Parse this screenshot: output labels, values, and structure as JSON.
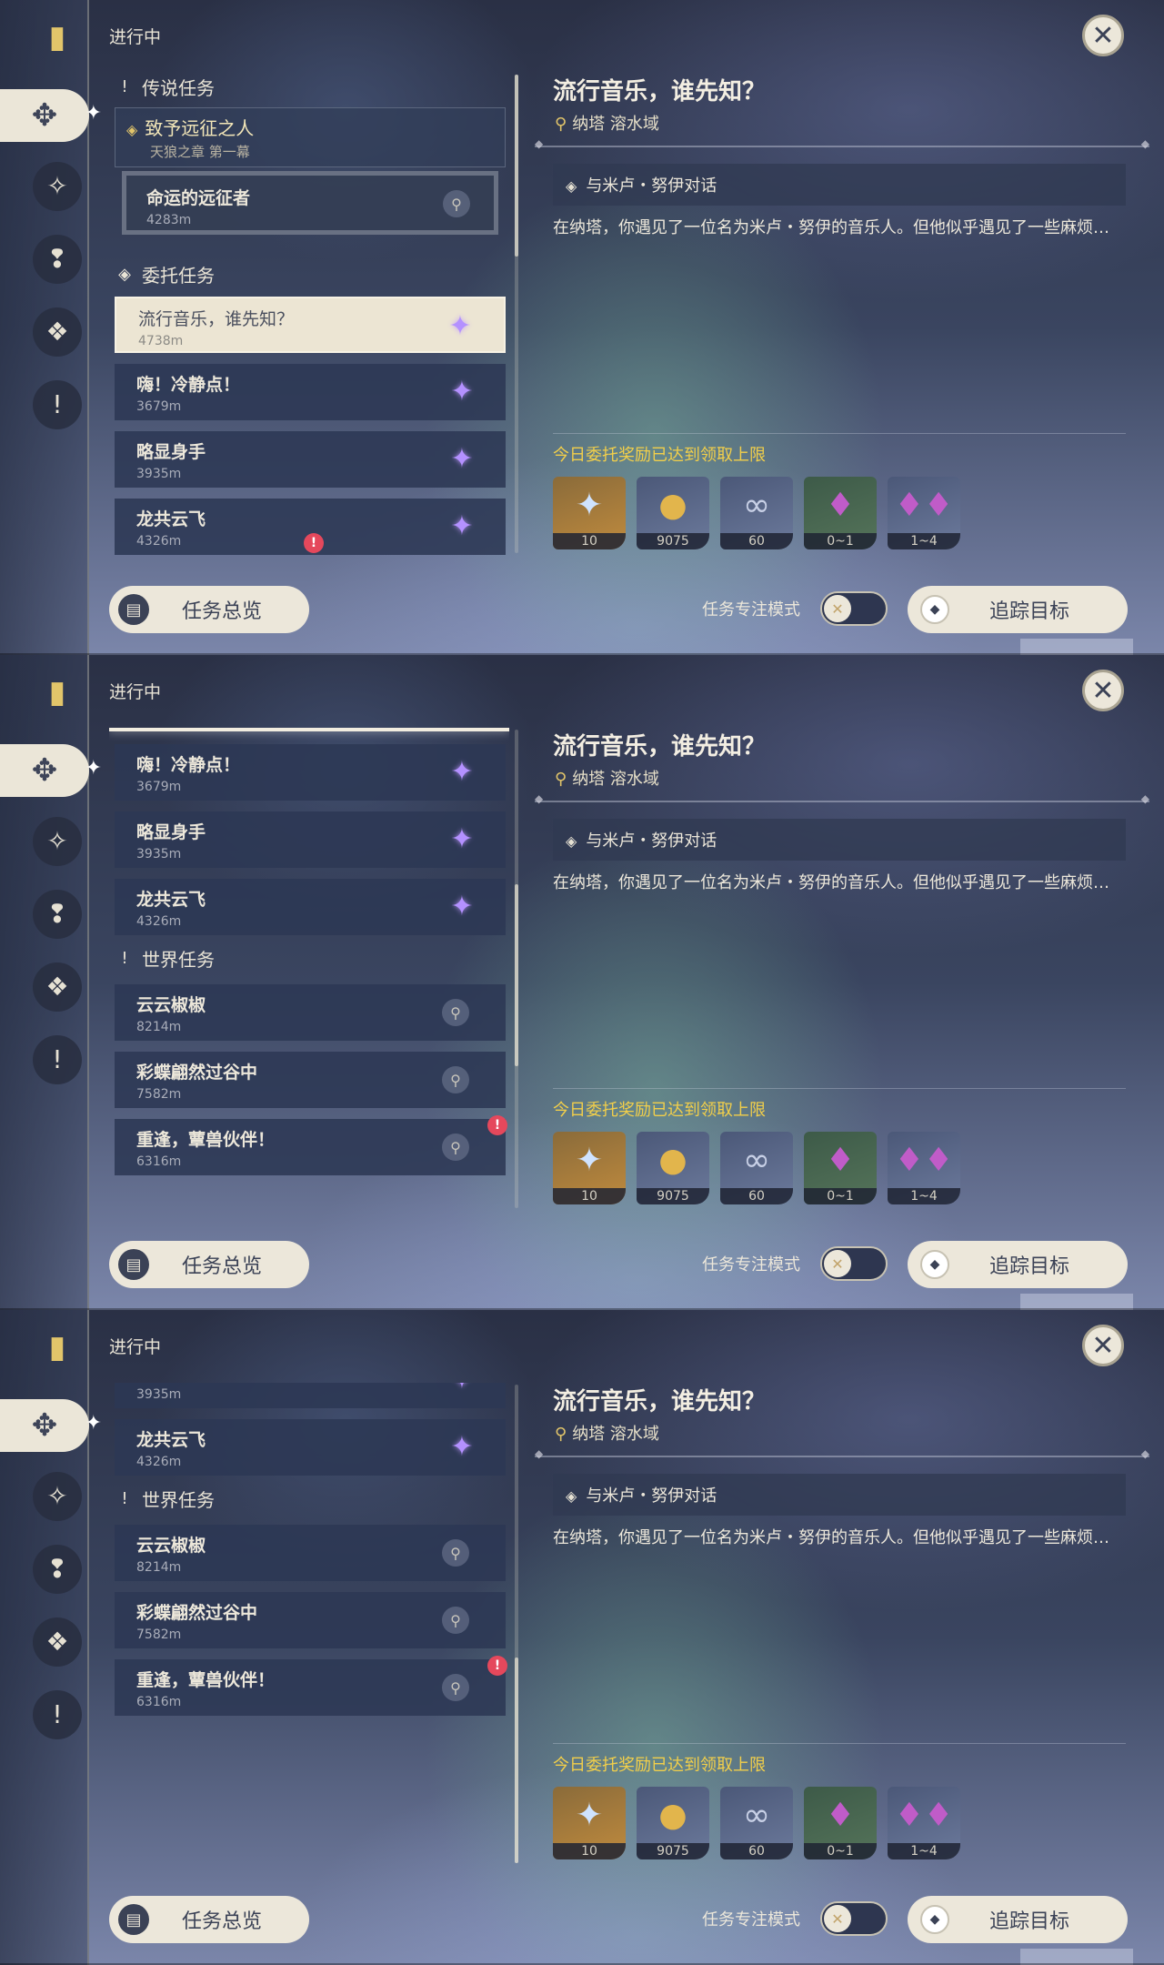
{
  "header": {
    "in_progress": "进行中",
    "close_icon": "✕"
  },
  "sections": {
    "legend": "传说任务",
    "commission": "委托任务",
    "world": "世界任务"
  },
  "legend_quest": {
    "name": "致予远征之人",
    "sub": "天狼之章 第一幕"
  },
  "sub_quest": {
    "name": "命运的远征者",
    "dist": "4283m"
  },
  "quests": {
    "q1": {
      "name": "流行音乐，谁先知？",
      "dist": "4738m"
    },
    "q2": {
      "name": "嗨！冷静点！",
      "dist": "3679m"
    },
    "q3": {
      "name": "略显身手",
      "dist": "3935m"
    },
    "q4": {
      "name": "龙共云飞",
      "dist": "4326m"
    },
    "w1": {
      "name": "云云椒椒",
      "dist": "8214m"
    },
    "w2": {
      "name": "彩蝶翩然过谷中",
      "dist": "7582m"
    },
    "w3": {
      "name": "重逢，蕈兽伙伴！",
      "dist": "6316m"
    }
  },
  "detail": {
    "title": "流行音乐，谁先知？",
    "location": "纳塔 溶水域",
    "objective": "与米卢・努伊对话",
    "description": "在纳塔，你遇见了一位名为米卢・努伊的音乐人。但他似乎遇见了一些麻烦…",
    "reward_notice": "今日委托奖励已达到领取上限",
    "rewards": [
      "10",
      "9075",
      "60",
      "0~1",
      "1~4"
    ]
  },
  "bottom": {
    "overview": "任务总览",
    "focus_mode": "任务专注模式",
    "track": "追踪目标"
  },
  "colors": {
    "accent_gold": "#f2cf4a",
    "alert_red": "#e5485c",
    "marker_purple": "#b491ff"
  },
  "icons": {
    "rail": [
      "bookmark-icon",
      "commission-icon",
      "legend-icon",
      "world-icon",
      "archon-icon",
      "exclamation-icon"
    ],
    "rewards": [
      "primogem-icon",
      "mora-icon",
      "xp-icon",
      "crystal-icon",
      "crystal-cluster-icon"
    ]
  }
}
